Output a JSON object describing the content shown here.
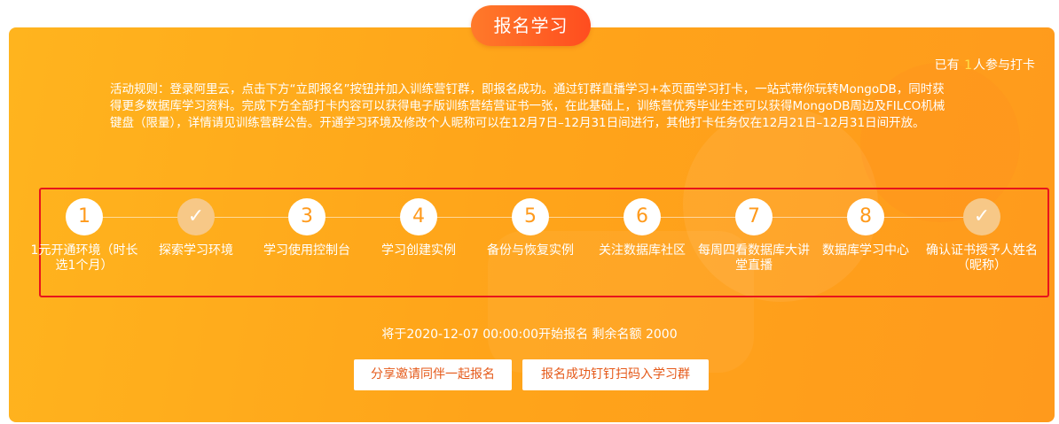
{
  "header": {
    "title": "报名学习"
  },
  "participants": {
    "prefix": "已有",
    "count": "1",
    "suffix": "人参与打卡"
  },
  "rules": {
    "text": "活动规则：登录阿里云，点击下方“立即报名”按钮并加入训练营钉群，即报名成功。通过钉群直播学习+本页面学习打卡，一站式带你玩转MongoDB，同时获得更多数据库学习资料。完成下方全部打卡内容可以获得电子版训练营结营证书一张，在此基础上，训练营优秀毕业生还可以获得MongoDB周边及FILCO机械键盘（限量），详情请见训练营群公告。开通学习环境及修改个人昵称可以在12月7日–12月31日间进行，其他打卡任务仅在12月21日–12月31日间开放。"
  },
  "steps": [
    {
      "marker": "1",
      "done": false,
      "label": "1元开通环境（时长选1个月）"
    },
    {
      "marker": "✓",
      "done": true,
      "label": "探索学习环境"
    },
    {
      "marker": "3",
      "done": false,
      "label": "学习使用控制台"
    },
    {
      "marker": "4",
      "done": false,
      "label": "学习创建实例"
    },
    {
      "marker": "5",
      "done": false,
      "label": "备份与恢复实例"
    },
    {
      "marker": "6",
      "done": false,
      "label": "关注数据库社区"
    },
    {
      "marker": "7",
      "done": false,
      "label": "每周四看数据库大讲堂直播"
    },
    {
      "marker": "8",
      "done": false,
      "label": "数据库学习中心"
    },
    {
      "marker": "✓",
      "done": true,
      "label": "确认证书授予人姓名（昵称）"
    }
  ],
  "status": {
    "start_text": "将于2020-12-07 00:00:00开始报名 剩余名额 2000"
  },
  "buttons": {
    "share_label": "分享邀请同伴一起报名",
    "join_label": "报名成功钉钉扫码入学习群"
  },
  "colors": {
    "panel": "#ffa51a",
    "title_pill": "#ff5a20",
    "highlight_frame": "#e8141c",
    "participant_count": "#ffe04a"
  }
}
